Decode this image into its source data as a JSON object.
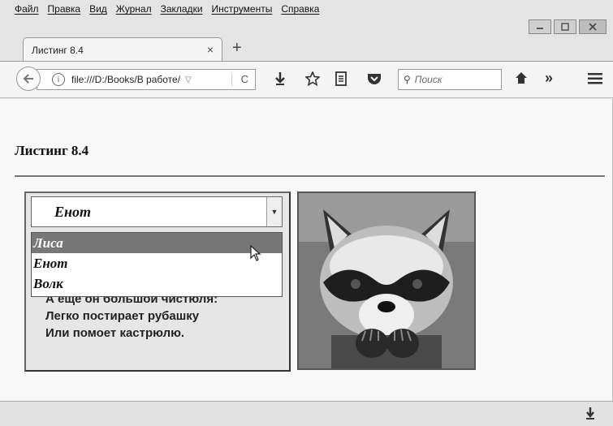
{
  "menu": [
    "Файл",
    "Правка",
    "Вид",
    "Журнал",
    "Закладки",
    "Инструменты",
    "Справка"
  ],
  "tab": {
    "title": "Листинг 8.4",
    "close": "×",
    "new_tab": "+"
  },
  "nav": {
    "url": "file:///D:/Books/В работе/",
    "search_placeholder": "Поиск",
    "reload_glyph": "C",
    "info_glyph": "i"
  },
  "page": {
    "heading": "Листинг 8.4",
    "select": {
      "value": "Енот",
      "options": [
        "Лиса",
        "Енот",
        "Волк"
      ],
      "highlighted": "Лиса"
    },
    "poem": [
      "А еще он большой чистюля:",
      "Легко постирает рубашку",
      "Или помоет кастрюлю."
    ],
    "image_subject": "raccoon"
  },
  "icons": [
    "back-arrow-icon",
    "info-icon",
    "reload-icon",
    "download-icon",
    "bookmark-star-icon",
    "reader-icon",
    "pocket-icon",
    "search-icon",
    "home-icon",
    "overflow-icon",
    "menu-icon"
  ]
}
